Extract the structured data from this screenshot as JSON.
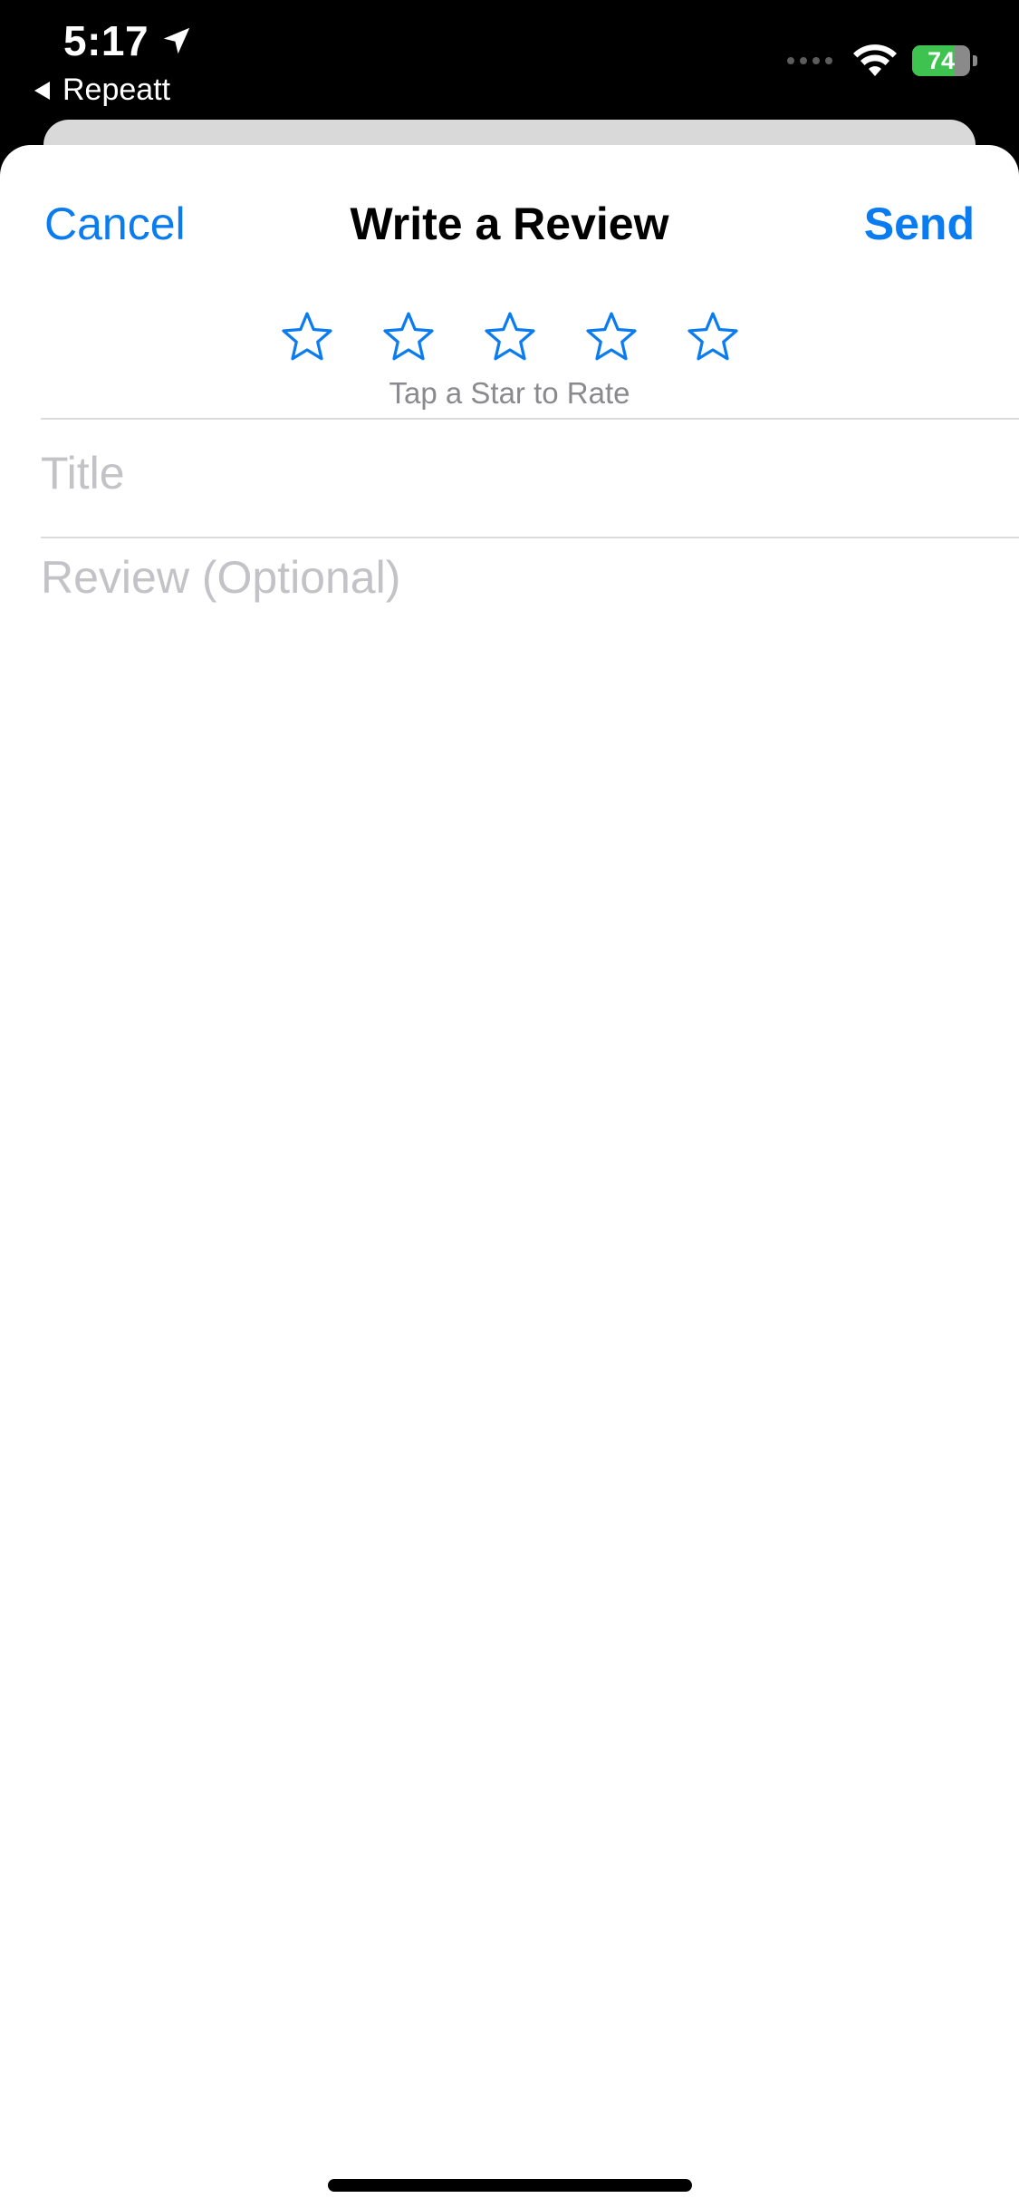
{
  "status_bar": {
    "time": "5:17",
    "back_app_label": "Repeatt",
    "battery_level": "74",
    "battery_fraction": 0.74,
    "battery_color": "#3fc350"
  },
  "nav": {
    "cancel_label": "Cancel",
    "title": "Write a Review",
    "send_label": "Send"
  },
  "rating": {
    "max_stars": 5,
    "selected": 0,
    "hint": "Tap a Star to Rate",
    "star_icon": "star-outline-icon"
  },
  "form": {
    "title_placeholder": "Title",
    "review_placeholder": "Review (Optional)"
  },
  "colors": {
    "accent": "#0a7cf0",
    "placeholder": "#c3c3c7",
    "hint": "#8a8a8e"
  }
}
